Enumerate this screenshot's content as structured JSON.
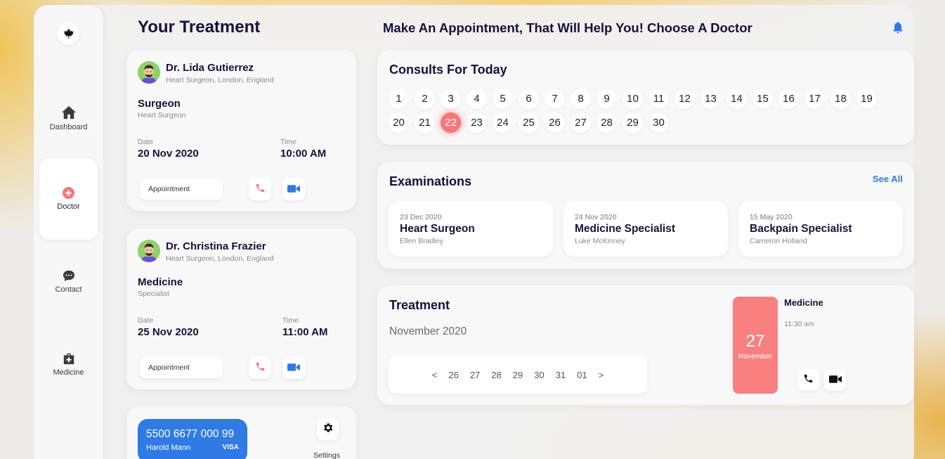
{
  "header": {
    "left_title": "Your Treatment",
    "title": "Make An Appointment, That Will Help You! Choose A Doctor",
    "bell_icon": "bell-icon",
    "accent": "#2f7ae5"
  },
  "sidebar": {
    "logo_icon": "maple-leaf-icon",
    "items": [
      {
        "label": "Dashboard",
        "icon": "home-icon"
      },
      {
        "label": "Doctor",
        "icon": "plus-circle-icon",
        "active": true
      },
      {
        "label": "Contact",
        "icon": "chat-icon"
      },
      {
        "label": "Medicine",
        "icon": "first-aid-kit-icon"
      }
    ]
  },
  "doctors": [
    {
      "name": "Dr. Lida Gutierrez",
      "subtitle": "Heart Surgeon, London, England",
      "specialty": "Surgeon",
      "specialty_sub": "Heart Surgeon",
      "date_label": "Date",
      "date": "20 Nov 2020",
      "time_label": "Time",
      "time": "10:00 AM",
      "button": "Appointment"
    },
    {
      "name": "Dr. Christina Frazier",
      "subtitle": "Heart Surgeon, London, England",
      "specialty": "Medicine",
      "specialty_sub": "Specialist",
      "date_label": "Date",
      "date": "25 Nov 2020",
      "time_label": "Time",
      "time": "11:00 AM",
      "button": "Appointment"
    }
  ],
  "card": {
    "number": "5500 6677 000 99",
    "holder": "Harold Mann",
    "brand": "VISA",
    "settings_label": "Settings",
    "color": "#2f7ae5"
  },
  "consults": {
    "title": "Consults For Today",
    "days": [
      "1",
      "2",
      "3",
      "4",
      "5",
      "6",
      "7",
      "8",
      "9",
      "10",
      "11",
      "12",
      "13",
      "14",
      "15",
      "16",
      "17",
      "18",
      "19",
      "20",
      "21",
      "22",
      "23",
      "24",
      "25",
      "26",
      "27",
      "28",
      "29",
      "30"
    ],
    "selected": "22",
    "selected_color": "#f8777a"
  },
  "examinations": {
    "title": "Examinations",
    "see_all": "See All",
    "items": [
      {
        "date": "23 Dec 2020",
        "title": "Heart Surgeon",
        "name": "Ellen Bradley"
      },
      {
        "date": "24 Nov 2020",
        "title": "Medicine Specialist",
        "name": "Luke McKinney"
      },
      {
        "date": "15 May 2020",
        "title": "Backpain Specialist",
        "name": "Cameron Holland"
      }
    ]
  },
  "treatment": {
    "title": "Treatment",
    "month": "November 2020",
    "strip": [
      "<",
      "26",
      "27",
      "28",
      "29",
      "30",
      "31",
      "01",
      ">"
    ],
    "event_day": "27",
    "event_month": "November",
    "event_title": "Medicine",
    "event_time": "11:30 am",
    "event_color": "#fa8080"
  }
}
